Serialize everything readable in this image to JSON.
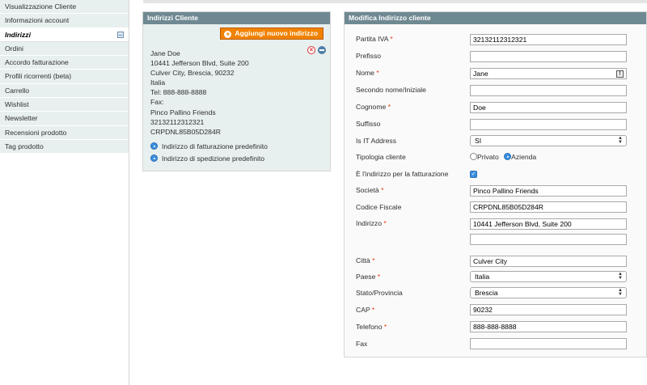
{
  "sidebar": {
    "items": [
      {
        "label": "Visualizzazione Cliente"
      },
      {
        "label": "Informazioni account"
      },
      {
        "label": "Indirizzi"
      },
      {
        "label": "Ordini"
      },
      {
        "label": "Accordo fatturazione"
      },
      {
        "label": "Profili ricorrenti (beta)"
      },
      {
        "label": "Carrello"
      },
      {
        "label": "Wishlist"
      },
      {
        "label": "Newsletter"
      },
      {
        "label": "Recensioni prodotto"
      },
      {
        "label": "Tag prodotto"
      }
    ]
  },
  "addresses": {
    "header": "Indirizzi Cliente",
    "add_button": "Aggiungi nuovo indirizzo",
    "address": {
      "line1": "Jane Doe",
      "line2": "10441 Jefferson Blvd, Suite 200",
      "line3": "Culver City, Brescia, 90232",
      "line4": "Italia",
      "line5": "Tel: 888-888-8888",
      "line6": "Fax:",
      "line7": "Pinco Pallino Friends",
      "line8": "32132112312321",
      "line9": "CRPDNL85B05D284R"
    },
    "default_billing": "Indirizzo di fatturazione predefinito",
    "default_shipping": "Indirizzo di spedizione predefinito"
  },
  "form": {
    "header": "Modifica Indirizzo cliente",
    "required_mark": "*",
    "partita_iva": {
      "label": "Partita IVA",
      "value": "32132112312321"
    },
    "prefisso": {
      "label": "Prefisso",
      "value": ""
    },
    "nome": {
      "label": "Nome",
      "value": "Jane"
    },
    "secondo_nome": {
      "label": "Secondo nome/Iniziale",
      "value": ""
    },
    "cognome": {
      "label": "Cognome",
      "value": "Doe"
    },
    "suffisso": {
      "label": "Suffisso",
      "value": ""
    },
    "is_it": {
      "label": "Is IT Address",
      "value": "SI"
    },
    "tipologia": {
      "label": "Tipologia cliente",
      "option1": "Privato",
      "option2": "Azienda",
      "selected": "Azienda"
    },
    "fatturazione": {
      "label": "È l'indirizzo per la fatturazione",
      "checked": true
    },
    "societa": {
      "label": "Società",
      "value": "Pinco Pallino Friends"
    },
    "codice_fiscale": {
      "label": "Codice Fiscale",
      "value": "CRPDNL85B05D284R"
    },
    "indirizzo": {
      "label": "Indirizzo",
      "value": "10441 Jefferson Blvd, Suite 200",
      "value2": ""
    },
    "citta": {
      "label": "Città",
      "value": "Culver City"
    },
    "paese": {
      "label": "Paese",
      "value": "Italia"
    },
    "stato": {
      "label": "Stato/Provincia",
      "value": "Brescia"
    },
    "cap": {
      "label": "CAP",
      "value": "90232"
    },
    "telefono": {
      "label": "Telefono",
      "value": "888-888-8888"
    },
    "fax": {
      "label": "Fax",
      "value": ""
    }
  },
  "colors": {
    "accent": "#f18200",
    "header": "#6f8992",
    "sidebar_bg": "#e7efef",
    "required": "#eb340a",
    "radio_blue": "#3b8fe0"
  }
}
